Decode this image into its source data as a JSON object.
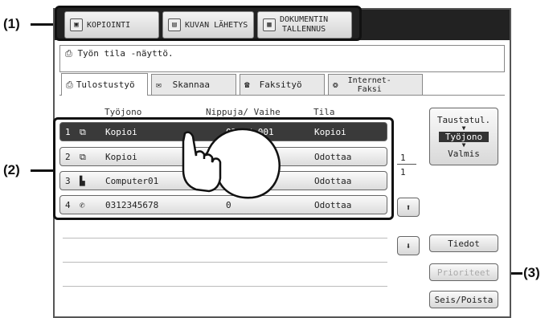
{
  "callouts": {
    "c1": "(1)",
    "c2": "(2)",
    "c3": "(3)"
  },
  "modes": [
    {
      "label": "KOPIOINTI",
      "icon": "copy-icon"
    },
    {
      "label": "KUVAN LÄHETYS",
      "icon": "send-icon"
    },
    {
      "label": "DOKUMENTIN TALLENNUS",
      "label1": "DOKUMENTIN",
      "label2": "TALLENNUS",
      "icon": "storage-icon"
    }
  ],
  "status_message": "Työn tila -näyttö.",
  "tabs": [
    {
      "label": "Tulostustyö",
      "icon": "printer-icon",
      "active": true
    },
    {
      "label": "Skannaa",
      "icon": "scan-icon"
    },
    {
      "label": "Faksityö",
      "icon": "fax-icon"
    },
    {
      "label": "Internet-Faksi",
      "label1": "Internet-",
      "label2": "Faksi",
      "icon": "internet-fax-icon"
    }
  ],
  "columns": {
    "queue": "Työjono",
    "sets": "Nippuja/ Vaihe",
    "status": "Tila"
  },
  "jobs": [
    {
      "num": "1",
      "icon": "copy-job-icon",
      "name": "Kopioi",
      "sets": "020 / 001",
      "status": "Kopioi"
    },
    {
      "num": "2",
      "icon": "copy-job-icon",
      "name": "Kopioi",
      "sets": "",
      "status": "Odottaa"
    },
    {
      "num": "3",
      "icon": "computer-job-icon",
      "name": "Computer01",
      "sets": "",
      "status": "Odottaa"
    },
    {
      "num": "4",
      "icon": "fax-job-icon",
      "name": "0312345678",
      "sets": "0",
      "status": "Odottaa"
    }
  ],
  "page_indicator": {
    "current": "1",
    "total": "1"
  },
  "toggle": {
    "top": "Taustatul.",
    "mid": "Työjono",
    "bottom": "Valmis"
  },
  "buttons": {
    "details": "Tiedot",
    "priority": "Prioriteet",
    "stop": "Seis/Poista"
  }
}
